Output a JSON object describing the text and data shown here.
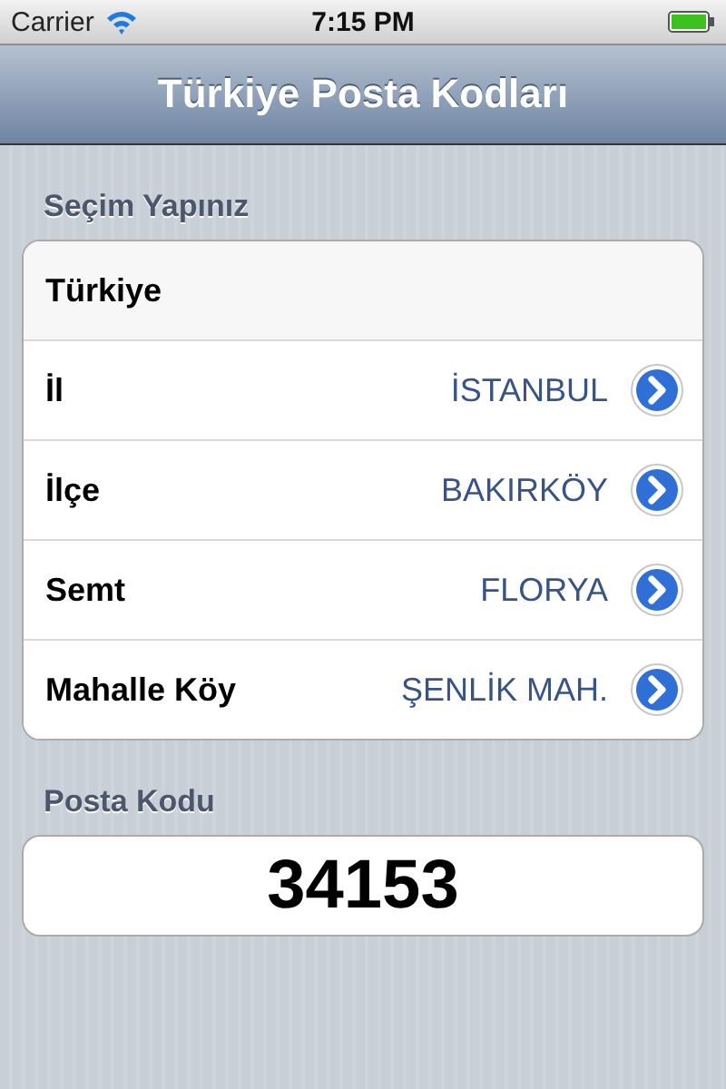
{
  "status_bar": {
    "carrier": "Carrier",
    "time": "7:15 PM"
  },
  "nav_bar": {
    "title": "Türkiye Posta Kodları"
  },
  "selection": {
    "header": "Seçim Yapınız",
    "rows": [
      {
        "kind": "plain",
        "label": "Türkiye"
      },
      {
        "kind": "disclosure",
        "label": "İl",
        "value": "İSTANBUL"
      },
      {
        "kind": "disclosure",
        "label": "İlçe",
        "value": "BAKIRKÖY"
      },
      {
        "kind": "disclosure",
        "label": "Semt",
        "value": "FLORYA"
      },
      {
        "kind": "disclosure",
        "label": "Mahalle Köy",
        "value": "ŞENLİK MAH."
      }
    ]
  },
  "postal_code": {
    "header": "Posta Kodu",
    "value": "34153"
  }
}
